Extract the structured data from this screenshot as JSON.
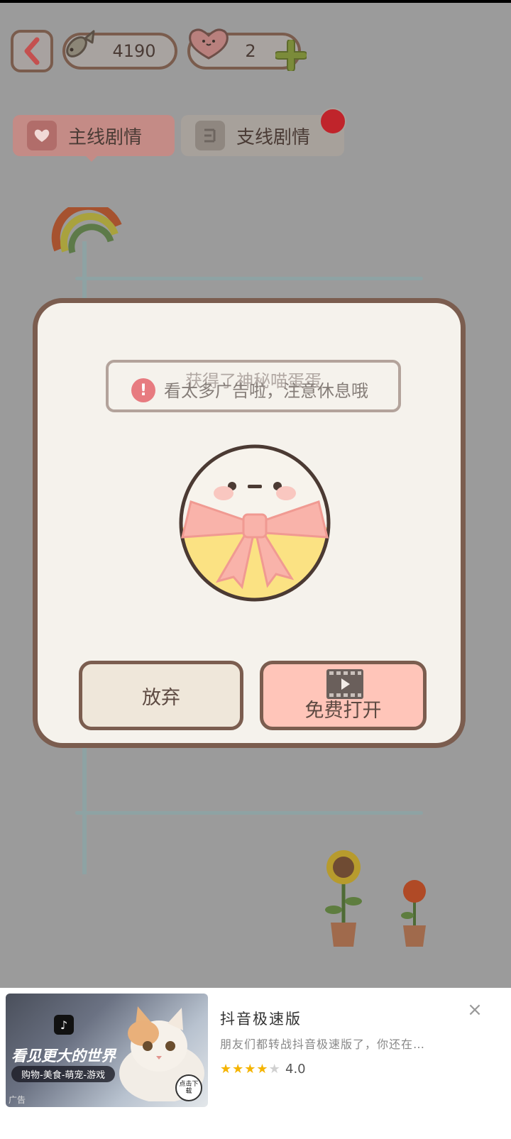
{
  "header": {
    "coins": "4190",
    "hearts": "2"
  },
  "tabs": [
    {
      "label": "主线剧情"
    },
    {
      "label": "支线剧情"
    }
  ],
  "dialog": {
    "title": "获得了神秘喵蛋蛋",
    "toast": "看太多广告啦，注意休息哦",
    "buttons": {
      "give_up": "放弃",
      "free_open": "免费打开"
    }
  },
  "ad": {
    "headline": "看见更大的世界",
    "subline": "购物-美食-萌宠-游戏",
    "download": "点击下载",
    "tag": "广告",
    "app_name": "抖音极速版",
    "description": "朋友们都转战抖音极速版了，你还在…",
    "rating": "4.0",
    "stars": 4
  },
  "colors": {
    "overlay": "#9b9b9b",
    "dialog_border": "#7b5d4f",
    "dialog_bg": "#f5f2ec",
    "accent_pink": "#ffc5b9",
    "star": "#f5b400"
  }
}
